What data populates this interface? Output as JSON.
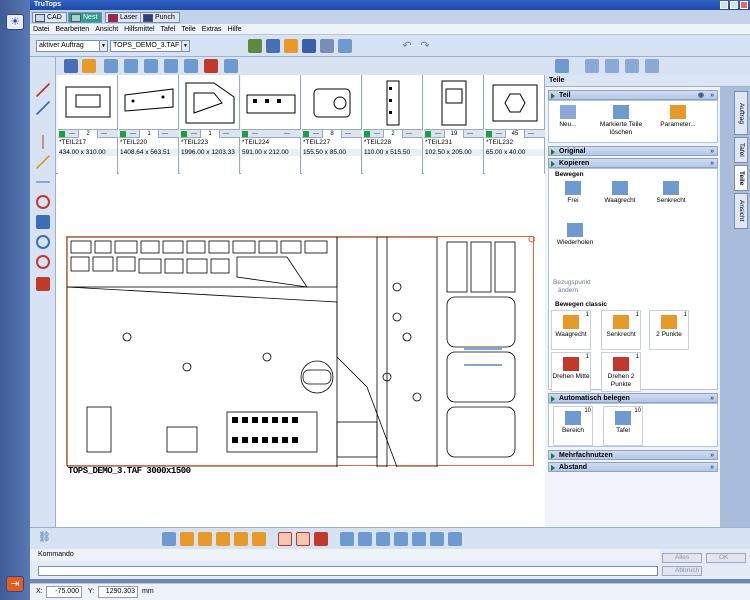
{
  "window": {
    "title": "TruTops"
  },
  "app_tabs": [
    {
      "label": "CAD",
      "color": "#cfd8ea"
    },
    {
      "label": "Nest",
      "color": "#2e9d8d"
    },
    {
      "label": "Laser",
      "color": "#b9174e"
    },
    {
      "label": "Punch",
      "color": "#2d3f80"
    }
  ],
  "menu": [
    "Datei",
    "Bearbeiten",
    "Ansicht",
    "Hilfsmittel",
    "Tafel",
    "Teile",
    "Extras",
    "Hilfe"
  ],
  "toolbar": {
    "order_select": "aktiver Auftrag",
    "file_select": "TOPS_DEMO_3.TAF"
  },
  "parts": [
    {
      "name": "TEIL217",
      "qty": "2",
      "dims": "434.00 x 310.00"
    },
    {
      "name": "TEIL220",
      "qty": "1",
      "dims": "1408.64 x 563.51"
    },
    {
      "name": "TEIL223",
      "qty": "1",
      "dims": "1996.00 x 1203.33"
    },
    {
      "name": "TEIL224",
      "qty": "",
      "dims": "591.00 x 212.00"
    },
    {
      "name": "TEIL227",
      "qty": "8",
      "dims": "155.50 x 85.00"
    },
    {
      "name": "TEIL228",
      "qty": "2",
      "dims": "110.00 x 515.50"
    },
    {
      "name": "TEIL231",
      "qty": "19",
      "dims": "102.50 x 205.00"
    },
    {
      "name": "TEIL232",
      "qty": "45",
      "dims": "65.00 x 40.00"
    }
  ],
  "part_counter": {
    "minus": "---",
    "plus": "---"
  },
  "sheet": {
    "title": "TOPS_DEMO_3.TAF 3000x1500"
  },
  "right_panel": {
    "header": "Teile",
    "teil": {
      "title": "Teil",
      "buttons": [
        "Neu...",
        "Markierte Teile löschen",
        "Parameter..."
      ]
    },
    "original": {
      "title": "Original"
    },
    "kopieren": {
      "title": "Kopieren",
      "sub_bewegen": "Bewegen",
      "bewegen_buttons": [
        "Frei",
        "Waagrecht",
        "Senkrecht"
      ],
      "wiederholen": "Wiederholen",
      "bezugspunkt": "Bezugspunkt ändern",
      "sub_classic": "Bewegen classic",
      "classic_buttons": [
        "Waagrecht",
        "Senkrecht",
        "2 Punkte",
        "Drehen Mitte",
        "Drehen 2 Punkte"
      ]
    },
    "auto": {
      "title": "Automatisch belegen",
      "buttons": [
        "Bereich",
        "Tafel"
      ],
      "number": "10"
    },
    "mehrfach": {
      "title": "Mehrfachnutzen"
    },
    "abstand": {
      "title": "Abstand"
    },
    "classic_num": "1"
  },
  "vertical_tabs": [
    "Auftrag",
    "Tafel",
    "Teile",
    "Ansicht"
  ],
  "command": {
    "label": "Kommando",
    "alles": "Alles",
    "ok": "OK",
    "abbruch": "Abbruch"
  },
  "status": {
    "x_label": "X:",
    "x_value": "-75.000",
    "y_label": "Y:",
    "y_value": "1290.303",
    "unit": "mm"
  }
}
